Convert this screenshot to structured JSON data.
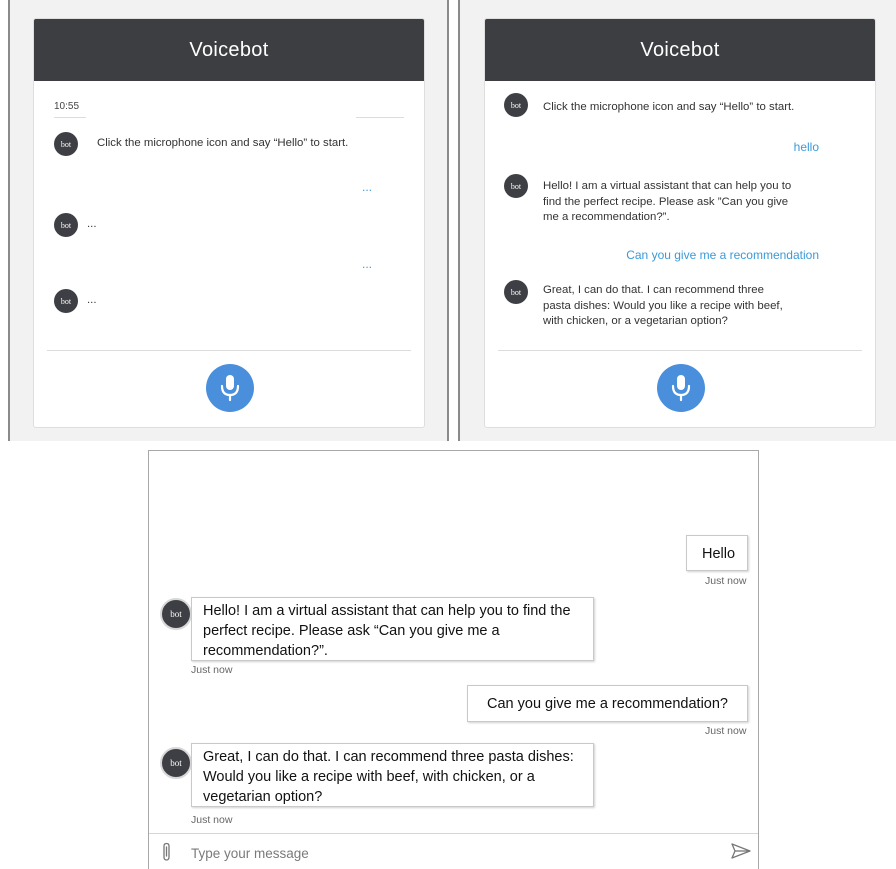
{
  "panel_left": {
    "title": "Voicebot",
    "timestamp": "10:55",
    "avatar_label": "bot",
    "messages": [
      {
        "from": "bot",
        "text": "Click the microphone icon and say “Hello” to start."
      },
      {
        "from": "user",
        "text": "..."
      },
      {
        "from": "bot",
        "text": "..."
      },
      {
        "from": "user",
        "text": "..."
      },
      {
        "from": "bot",
        "text": "..."
      }
    ],
    "mic_icon": "microphone-icon"
  },
  "panel_right": {
    "title": "Voicebot",
    "avatar_label": "bot",
    "messages": [
      {
        "from": "bot",
        "text": "Click the microphone icon and say “Hello” to start."
      },
      {
        "from": "user",
        "text": "hello"
      },
      {
        "from": "bot",
        "text": "Hello! I am a virtual assistant that can help you to find the perfect recipe. Please ask ”Can you give me a recommendation?”."
      },
      {
        "from": "user",
        "text": "Can you give me a recommendation"
      },
      {
        "from": "bot",
        "text": "Great, I can do that. I can recommend three pasta dishes: Would you like a recipe with beef, with chicken, or a vegetarian option?"
      }
    ],
    "mic_icon": "microphone-icon"
  },
  "chat": {
    "avatar_label": "bot",
    "messages": [
      {
        "from": "user",
        "text": "Hello",
        "time": "Just now"
      },
      {
        "from": "bot",
        "text": "Hello! I am a virtual assistant that can help you to find the perfect recipe. Please ask “Can you give me a recommendation?”.",
        "time": "Just now"
      },
      {
        "from": "user",
        "text": "Can you give me a recommendation?",
        "time": "Just now"
      },
      {
        "from": "bot",
        "text": "Great, I can do that. I can recommend three pasta dishes: Would you like a recipe with beef, with chicken, or a vegetarian option?",
        "time": "Just now"
      }
    ],
    "input_placeholder": "Type your message",
    "attach_icon": "paperclip-icon",
    "send_icon": "send-icon"
  },
  "colors": {
    "header_bg": "#3c3e42",
    "mic_blue": "#4a8fdc",
    "user_text_blue": "#3a9ad9",
    "avatar_bg": "#3e3f44"
  }
}
